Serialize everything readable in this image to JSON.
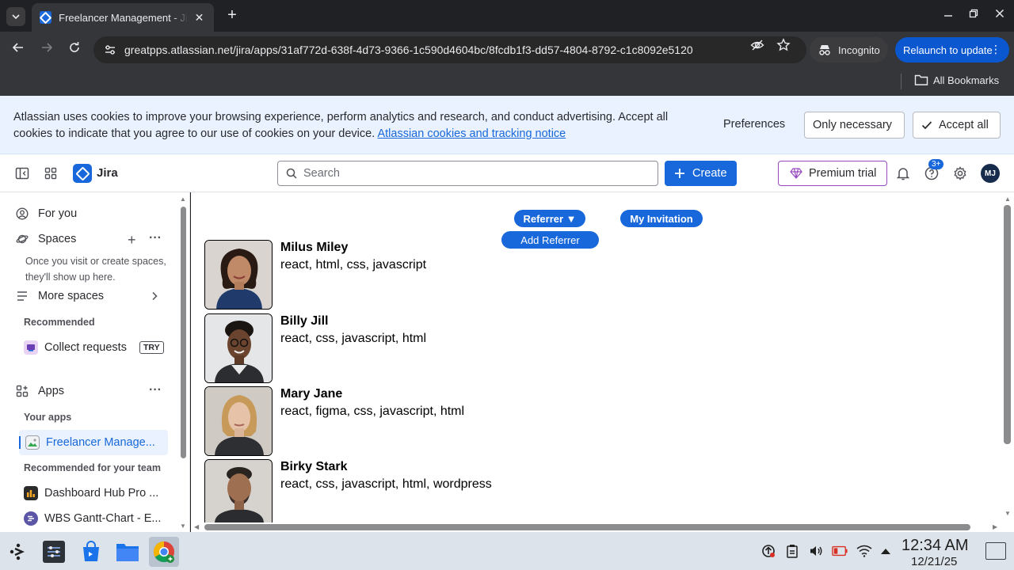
{
  "browser": {
    "tab_title": "Freelancer Management - Jira",
    "url": "greatpps.atlassian.net/jira/apps/31af772d-638f-4d73-9366-1c590d4604bc/8fcdb1f3-dd57-4804-8792-c1c8092e5120",
    "incognito_label": "Incognito",
    "relaunch_label": "Relaunch to update",
    "all_bookmarks_label": "All Bookmarks"
  },
  "cookie_banner": {
    "text": "Atlassian uses cookies to improve your browsing experience, perform analytics and research, and conduct advertising. Accept all cookies to indicate that you agree to our use of cookies on your device.",
    "link_text": "Atlassian cookies and tracking notice",
    "preferences_label": "Preferences",
    "only_necessary_label": "Only necessary",
    "accept_all_label": "Accept all"
  },
  "topnav": {
    "app_name": "Jira",
    "search_placeholder": "Search",
    "create_label": "Create",
    "premium_label": "Premium trial",
    "help_badge": "3+",
    "avatar_initials": "MJ"
  },
  "sidebar": {
    "for_you": "For you",
    "spaces": "Spaces",
    "spaces_hint": "Once you visit or create spaces, they'll show up here.",
    "more_spaces": "More spaces",
    "recommended_heading": "Recommended",
    "collect_requests": "Collect requests",
    "try_badge": "TRY",
    "apps": "Apps",
    "your_apps_heading": "Your apps",
    "freelancer_app": "Freelancer Manage...",
    "recommended_team_heading": "Recommended for your team",
    "dashboard_hub": "Dashboard Hub Pro ...",
    "wbs_gantt": "WBS Gantt-Chart - E..."
  },
  "main": {
    "referrer_label": "Referrer ▼",
    "add_referrer_label": "Add Referrer",
    "my_invitation_label": "My Invitation",
    "people": [
      {
        "name": "Milus Miley",
        "skills": "react, html, css, javascript"
      },
      {
        "name": "Billy Jill",
        "skills": "react, css, javascript, html"
      },
      {
        "name": "Mary Jane",
        "skills": "react, figma, css, javascript, html"
      },
      {
        "name": "Birky Stark",
        "skills": "react, css, javascript, html, wordpress"
      }
    ]
  },
  "taskbar": {
    "time": "12:34 AM",
    "date": "12/21/25"
  },
  "colors": {
    "brand_blue": "#1868db",
    "cookie_bg": "#e9f2fe",
    "premium_border": "#964ac0",
    "taskbar_bg": "#dde3ea"
  }
}
